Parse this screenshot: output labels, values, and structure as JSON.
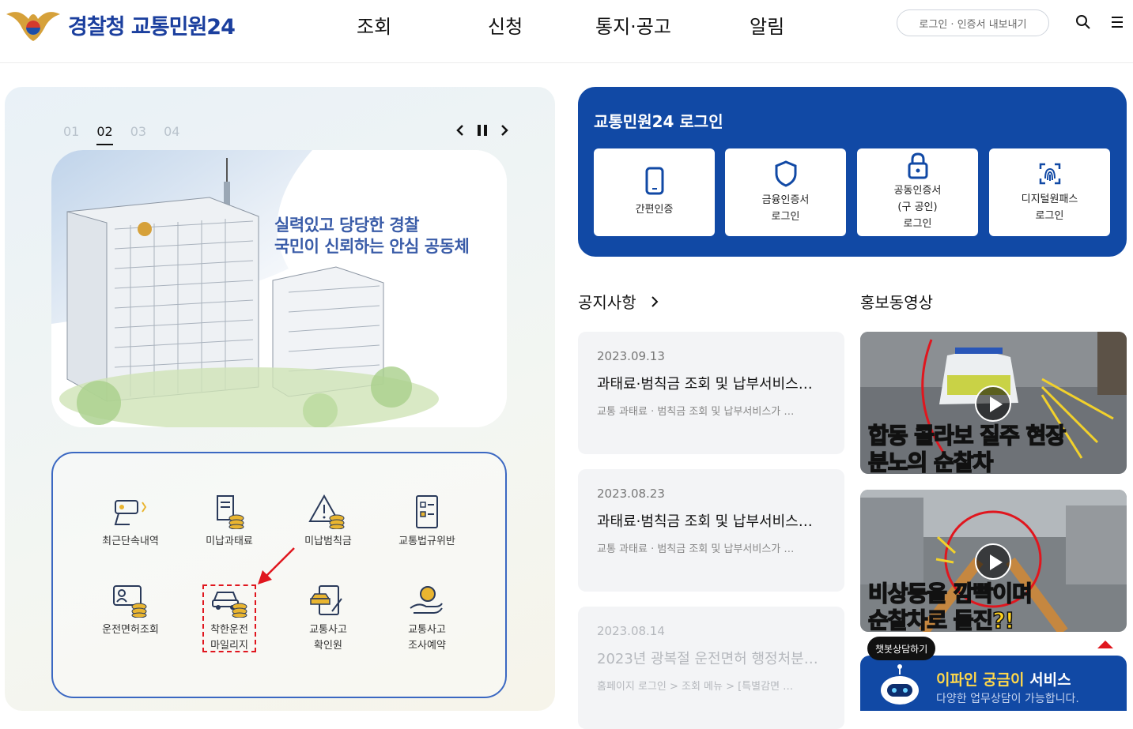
{
  "header": {
    "logo_text": "경찰청 교통민원24",
    "nav": [
      "조회",
      "신청",
      "통지·공고",
      "알림"
    ],
    "login_button": "로그인 · 인증서 내보내기",
    "search_icon": "search-icon",
    "menu_icon": "menu-icon"
  },
  "slider": {
    "pages": [
      "01",
      "02",
      "03",
      "04"
    ],
    "active_page": "02",
    "banner_line1": "실력있고 당당한 경찰",
    "banner_line2": "국민이 신뢰하는 안심 공동체"
  },
  "quick_menu": [
    {
      "label": "최근단속내역",
      "icon": "camera-icon"
    },
    {
      "label": "미납과태료",
      "icon": "invoice-coins-icon"
    },
    {
      "label": "미납범칙금",
      "icon": "warning-coins-icon"
    },
    {
      "label": "교통법규위반",
      "icon": "checklist-icon"
    },
    {
      "label": "운전면허조회",
      "icon": "license-card-icon"
    },
    {
      "label": "착한운전 마일리지",
      "line1": "착한운전",
      "line2": "마일리지",
      "icon": "car-coins-icon",
      "highlighted": true
    },
    {
      "label": "교통사고 확인원",
      "line1": "교통사고",
      "line2": "확인원",
      "icon": "accident-document-icon"
    },
    {
      "label": "교통사고 조사예약",
      "line1": "교통사고",
      "line2": "조사예약",
      "icon": "reservation-hand-icon"
    }
  ],
  "login": {
    "title": "교통민원24 로그인",
    "options": [
      {
        "line1": "간편인증",
        "icon": "phone-icon"
      },
      {
        "line1": "금융인증서",
        "line2": "로그인",
        "icon": "shield-icon"
      },
      {
        "line1": "공동인증서",
        "line2": "(구 공인)",
        "line3": "로그인",
        "icon": "lock-icon"
      },
      {
        "line1": "디지털원패스",
        "line2": "로그인",
        "icon": "fingerprint-icon"
      }
    ]
  },
  "notices": {
    "title": "공지사항",
    "items": [
      {
        "date": "2023.09.13",
        "title": "과태료·범칙금 조회 및 납부서비스…",
        "summary": "교통 과태료 · 범칙금 조회 및 납부서비스가 …"
      },
      {
        "date": "2023.08.23",
        "title": "과태료·범칙금 조회 및 납부서비스…",
        "summary": "교통 과태료 · 범칙금 조회 및 납부서비스가 …"
      },
      {
        "date": "2023.08.14",
        "title": "2023년 광복절 운전면허 행정처분…",
        "summary": "홈페이지 로그인 > 조회 메뉴 > [특별감면 …"
      }
    ]
  },
  "videos": {
    "title": "홍보동영상",
    "items": [
      {
        "caption1": "합동 콜라보 질주 현장",
        "caption2": "분노의 순찰차"
      },
      {
        "caption1": "비상등을 깜빡이며",
        "caption2": "순찰차로 돌진?!"
      }
    ]
  },
  "chatbot": {
    "pill": "챗봇상담하기",
    "title_highlight": "이파인 궁금이",
    "title_rest": " 서비스",
    "subtitle": "다양한 업무상담이 가능합니다."
  },
  "colors": {
    "brand": "#1149a5",
    "accent_red": "#e0161e",
    "logo_blue": "#1b3f9e"
  }
}
